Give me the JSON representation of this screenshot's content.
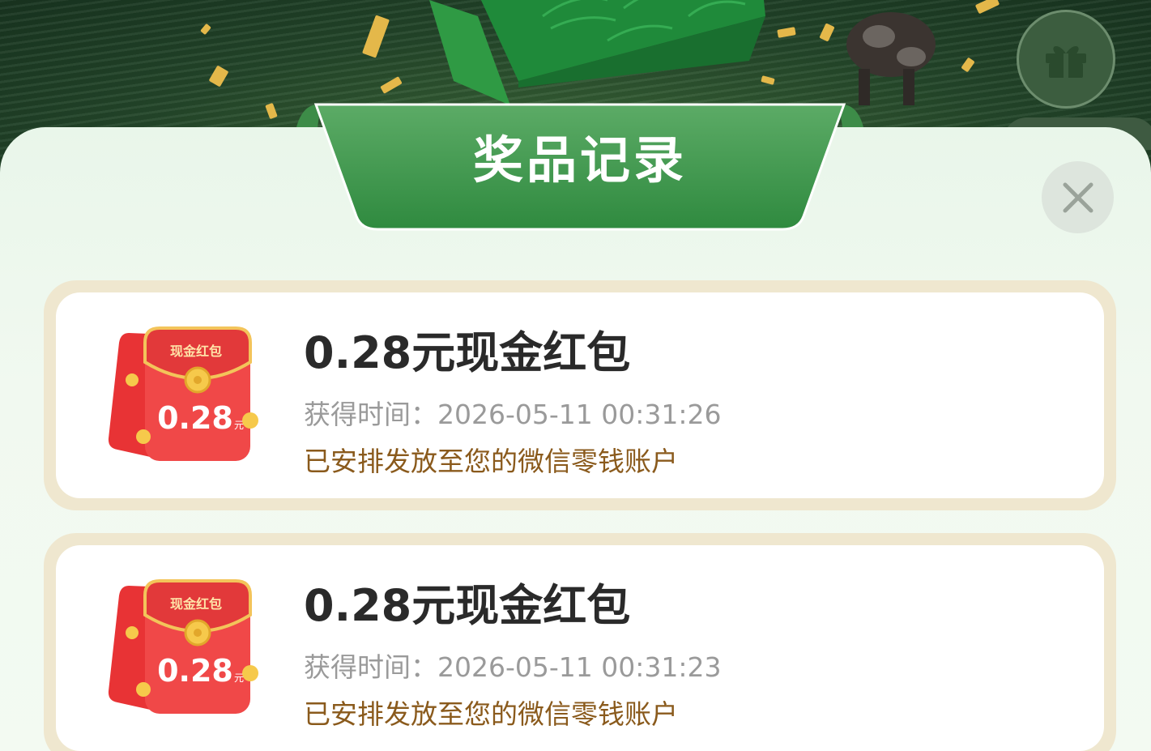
{
  "panel": {
    "title": "奖品记录"
  },
  "records": [
    {
      "title": "0.28元现金红包",
      "time_label": "获得时间：",
      "time_value": "2026-05-11 00:31:26",
      "note": "已安排发放至您的微信零钱账户",
      "envelope_label": "现金红包",
      "envelope_amount": "0.28",
      "envelope_unit": "元"
    },
    {
      "title": "0.28元现金红包",
      "time_label": "获得时间：",
      "time_value": "2026-05-11 00:31:23",
      "note": "已安排发放至您的微信零钱账户",
      "envelope_label": "现金红包",
      "envelope_amount": "0.28",
      "envelope_unit": "元"
    }
  ],
  "icons": {
    "gift": "gift-icon",
    "close": "close-icon",
    "envelope": "red-envelope-icon"
  },
  "colors": {
    "ribbon_green": "#3f9a4f",
    "envelope_red": "#ea3a3c",
    "note_brown": "#8a5a1c",
    "card_border": "#efe7cf"
  }
}
